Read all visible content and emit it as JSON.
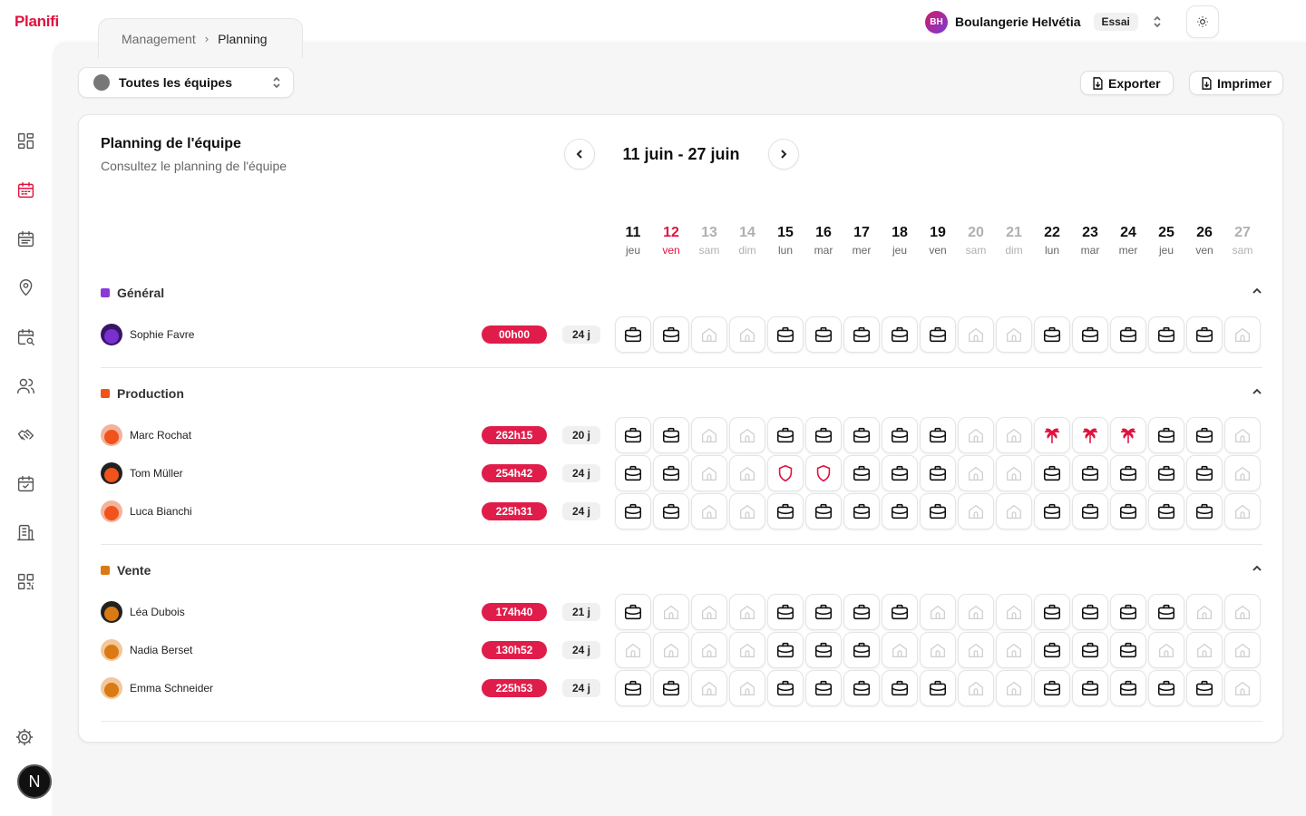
{
  "app": {
    "logo": "Planifi"
  },
  "breadcrumb": {
    "parent": "Management",
    "separator": "›",
    "current": "Planning"
  },
  "org": {
    "initials": "BH",
    "name": "Boulangerie Helvétia",
    "plan": "Essai"
  },
  "toolbar": {
    "team_select": "Toutes les équipes",
    "export_label": "Exporter",
    "print_label": "Imprimer"
  },
  "sidebar": {
    "items": [
      {
        "icon": "dashboard-icon"
      },
      {
        "icon": "calendar-icon",
        "active": true
      },
      {
        "icon": "calendar-list-icon"
      },
      {
        "icon": "location-pin-icon"
      },
      {
        "icon": "calendar-search-icon"
      },
      {
        "icon": "users-icon"
      },
      {
        "icon": "handshake-icon"
      },
      {
        "icon": "calendar-check-icon"
      },
      {
        "icon": "building-icon"
      },
      {
        "icon": "qr-code-icon"
      }
    ],
    "bottom_badge": "N"
  },
  "card": {
    "title": "Planning de l'équipe",
    "subtitle": "Consultez le planning de l'équipe",
    "date_range": "11 juin - 27 juin"
  },
  "days": [
    {
      "num": "11",
      "name": "jeu",
      "type": "normal"
    },
    {
      "num": "12",
      "name": "ven",
      "type": "today"
    },
    {
      "num": "13",
      "name": "sam",
      "type": "weekend"
    },
    {
      "num": "14",
      "name": "dim",
      "type": "weekend"
    },
    {
      "num": "15",
      "name": "lun",
      "type": "normal"
    },
    {
      "num": "16",
      "name": "mar",
      "type": "normal"
    },
    {
      "num": "17",
      "name": "mer",
      "type": "normal"
    },
    {
      "num": "18",
      "name": "jeu",
      "type": "normal"
    },
    {
      "num": "19",
      "name": "ven",
      "type": "normal"
    },
    {
      "num": "20",
      "name": "sam",
      "type": "weekend"
    },
    {
      "num": "21",
      "name": "dim",
      "type": "weekend"
    },
    {
      "num": "22",
      "name": "lun",
      "type": "normal"
    },
    {
      "num": "23",
      "name": "mar",
      "type": "normal"
    },
    {
      "num": "24",
      "name": "mer",
      "type": "normal"
    },
    {
      "num": "25",
      "name": "jeu",
      "type": "normal"
    },
    {
      "num": "26",
      "name": "ven",
      "type": "normal"
    },
    {
      "num": "27",
      "name": "sam",
      "type": "weekend"
    }
  ],
  "colors": {
    "accent": "#e0123f",
    "general": "#8a3ad6",
    "production": "#f0531c",
    "vente": "#d97a14"
  },
  "groups": [
    {
      "name": "Général",
      "color": "#8a3ad6",
      "employees": [
        {
          "name": "Sophie Favre",
          "hours": "00h00",
          "days": "24 j",
          "avatar_bg": "#3a1566",
          "avatar_face": "#7a2fd0",
          "cells": [
            "W",
            "W",
            "H",
            "H",
            "W",
            "W",
            "W",
            "W",
            "W",
            "H",
            "H",
            "W",
            "W",
            "W",
            "W",
            "W",
            "H"
          ]
        }
      ]
    },
    {
      "name": "Production",
      "color": "#f0531c",
      "employees": [
        {
          "name": "Marc Rochat",
          "hours": "262h15",
          "days": "20 j",
          "avatar_bg": "#f3b39a",
          "avatar_face": "#f0531c",
          "cells": [
            "W",
            "W",
            "H",
            "H",
            "W",
            "W",
            "W",
            "W",
            "W",
            "H",
            "H",
            "V",
            "V",
            "V",
            "W",
            "W",
            "H"
          ]
        },
        {
          "name": "Tom Müller",
          "hours": "254h42",
          "days": "24 j",
          "avatar_bg": "#222222",
          "avatar_face": "#f0531c",
          "cells": [
            "W",
            "W",
            "H",
            "H",
            "S",
            "S",
            "W",
            "W",
            "W",
            "H",
            "H",
            "W",
            "W",
            "W",
            "W",
            "W",
            "H"
          ]
        },
        {
          "name": "Luca Bianchi",
          "hours": "225h31",
          "days": "24 j",
          "avatar_bg": "#f3b39a",
          "avatar_face": "#f0531c",
          "cells": [
            "W",
            "W",
            "H",
            "H",
            "W",
            "W",
            "W",
            "W",
            "W",
            "H",
            "H",
            "W",
            "W",
            "W",
            "W",
            "W",
            "H"
          ]
        }
      ]
    },
    {
      "name": "Vente",
      "color": "#d97a14",
      "employees": [
        {
          "name": "Léa Dubois",
          "hours": "174h40",
          "days": "21 j",
          "avatar_bg": "#222222",
          "avatar_face": "#d97a14",
          "cells": [
            "W",
            "H",
            "H",
            "H",
            "W",
            "W",
            "W",
            "W",
            "H",
            "H",
            "H",
            "W",
            "W",
            "W",
            "W",
            "H",
            "H"
          ]
        },
        {
          "name": "Nadia Berset",
          "hours": "130h52",
          "days": "24 j",
          "avatar_bg": "#f3c79a",
          "avatar_face": "#d97a14",
          "cells": [
            "H",
            "H",
            "H",
            "H",
            "W",
            "W",
            "W",
            "H",
            "H",
            "H",
            "H",
            "W",
            "W",
            "W",
            "H",
            "H",
            "H"
          ]
        },
        {
          "name": "Emma Schneider",
          "hours": "225h53",
          "days": "24 j",
          "avatar_bg": "#f3c79a",
          "avatar_face": "#d97a14",
          "cells": [
            "W",
            "W",
            "H",
            "H",
            "W",
            "W",
            "W",
            "W",
            "W",
            "H",
            "H",
            "W",
            "W",
            "W",
            "W",
            "W",
            "H"
          ]
        }
      ]
    }
  ]
}
